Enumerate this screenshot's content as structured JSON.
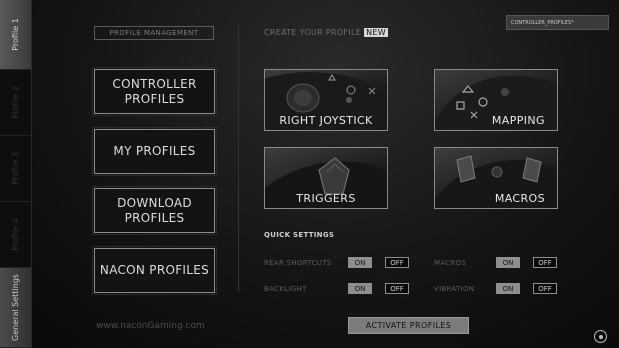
{
  "side_tabs": [
    {
      "label": "Profile 1",
      "active": true
    },
    {
      "label": "Profile 2",
      "active": false
    },
    {
      "label": "Profile 3",
      "active": false
    },
    {
      "label": "Profile 4",
      "active": false
    },
    {
      "label": "General Settings",
      "active": false
    }
  ],
  "left": {
    "section_label": "PROFILE MANAGEMENT",
    "buttons": [
      "CONTROLLER PROFILES",
      "MY PROFILES",
      "DOWNLOAD PROFILES",
      "NACON PROFILES"
    ],
    "website": "www.naconGaming.com"
  },
  "create": {
    "label": "CREATE YOUR PROFILE",
    "badge": "NEW"
  },
  "profile_field": {
    "value": "CONTROLLER_PROFILES*"
  },
  "tiles": {
    "right_joystick": "RIGHT JOYSTICK",
    "mapping": "MAPPING",
    "triggers": "TRIGGERS",
    "macros": "MACROS"
  },
  "quick_settings": {
    "title": "QUICK SETTINGS",
    "rear_shortcuts": {
      "label": "REAR SHORTCUTS",
      "on": "ON",
      "off": "OFF",
      "state": "ON"
    },
    "macros": {
      "label": "MACROS",
      "on": "ON",
      "off": "OFF",
      "state": "ON"
    },
    "backlight": {
      "label": "BACKLIGHT",
      "on": "ON",
      "off": "OFF",
      "state": "ON"
    },
    "vibration": {
      "label": "VIBRATION",
      "on": "ON",
      "off": "OFF",
      "state": "ON"
    }
  },
  "activate_label": "ACTIVATE PROFILES",
  "colors": {
    "background": "#0c0c0c",
    "frame": "#8d8d8d",
    "toggle_on": "#8e8e8e"
  }
}
